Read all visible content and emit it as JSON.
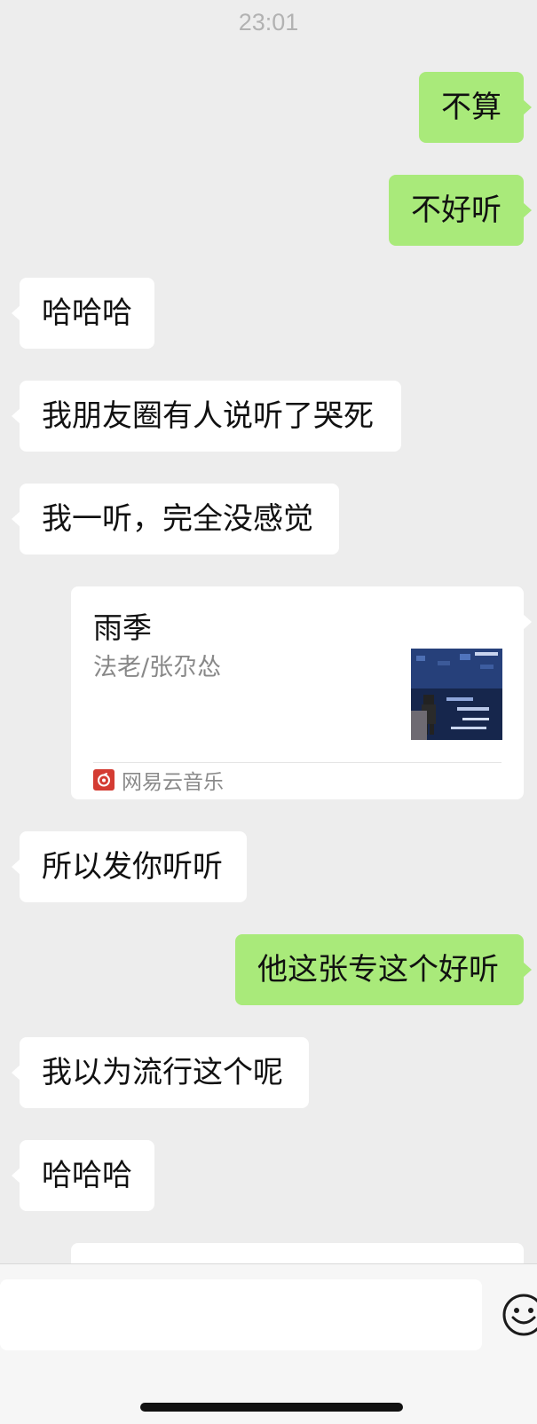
{
  "status": {
    "time": "23:01"
  },
  "messages": [
    {
      "side": "out",
      "text": "不算"
    },
    {
      "side": "out",
      "text": "不好听"
    },
    {
      "side": "in",
      "text": "哈哈哈"
    },
    {
      "side": "in",
      "text": "我朋友圈有人说听了哭死"
    },
    {
      "side": "in",
      "text": "我一听，完全没感觉"
    },
    {
      "side": "in",
      "text": "所以发你听听"
    },
    {
      "side": "out",
      "text": "他这张专这个好听"
    },
    {
      "side": "in",
      "text": "我以为流行这个呢"
    },
    {
      "side": "in",
      "text": "哈哈哈"
    }
  ],
  "music_card": {
    "title": "雨季",
    "artist": "法老/张尕怂",
    "source": "网易云音乐",
    "cover_icon": "album-cover"
  },
  "input_bar": {
    "value": "",
    "emoji_icon": "emoji-icon"
  },
  "colors": {
    "background": "#ededed",
    "outgoing_bubble": "#a9ea7a",
    "incoming_bubble": "#ffffff",
    "brand_red": "#d43c33"
  }
}
